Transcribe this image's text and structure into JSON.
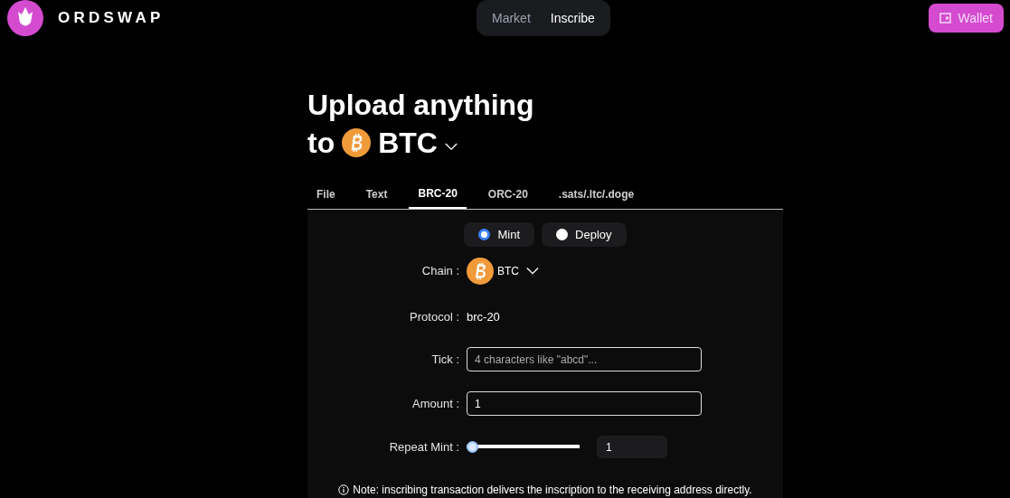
{
  "brand": {
    "name": "ORDSWAP"
  },
  "nav": [
    {
      "label": "Market",
      "selected": false
    },
    {
      "label": "Inscribe",
      "selected": true
    }
  ],
  "wallet_button": {
    "label": "Wallet"
  },
  "heading": {
    "line1": "Upload anything",
    "line2_prefix": "to",
    "chain": "BTC"
  },
  "tabs": [
    {
      "label": "File",
      "selected": false
    },
    {
      "label": "Text",
      "selected": false
    },
    {
      "label": "BRC-20",
      "selected": true
    },
    {
      "label": "ORC-20",
      "selected": false
    },
    {
      "label": ".sats/.ltc/.doge",
      "selected": false
    }
  ],
  "modes": [
    {
      "label": "Mint",
      "selected": true
    },
    {
      "label": "Deploy",
      "selected": false
    }
  ],
  "chain": {
    "label": "Chain :",
    "value": "BTC"
  },
  "protocol": {
    "label": "Protocol :",
    "value": "brc-20"
  },
  "tick": {
    "label": "Tick :",
    "placeholder": "4 characters like \"abcd\"..."
  },
  "amount": {
    "label": "Amount :",
    "value": "1"
  },
  "repeat_mint": {
    "label": "Repeat Mint :",
    "level": 0,
    "value": "1"
  },
  "note": "Note: inscribing transaction delivers the inscription to the receiving address directly."
}
